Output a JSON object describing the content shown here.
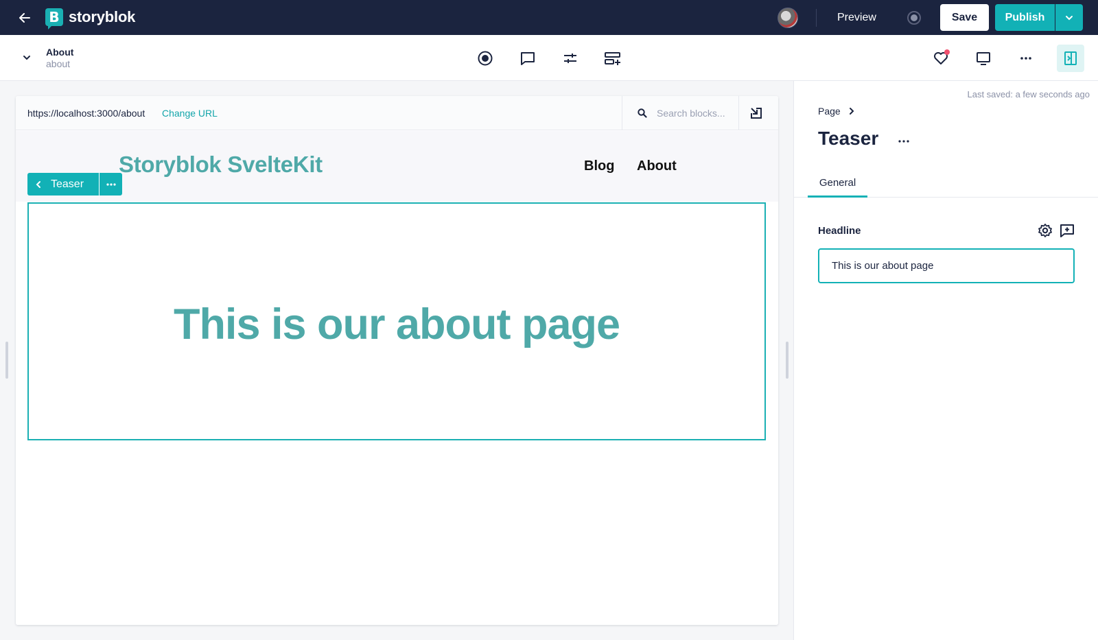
{
  "app": {
    "logo_letter": "B",
    "logo_text": "storyblok",
    "brand_color": "#12b1b6",
    "nav_bg": "#1b243f"
  },
  "topbar": {
    "preview_label": "Preview",
    "save_label": "Save",
    "publish_label": "Publish"
  },
  "story": {
    "name": "About",
    "slug": "about"
  },
  "toolbar_icons": [
    "target-icon",
    "comment-icon",
    "sliders-icon",
    "add-block-icon"
  ],
  "preview": {
    "url": "https://localhost:3000/about",
    "change_url_label": "Change URL",
    "search_placeholder": "Search blocks...",
    "site_title": "Storyblok SvelteKit",
    "nav": [
      "Blog",
      "About"
    ],
    "block_label": "Teaser",
    "teaser_headline": "This is our about page",
    "teaser_color": "#4fa9a8"
  },
  "panel": {
    "last_saved": "Last saved: a few seconds ago",
    "breadcrumb": "Page",
    "title": "Teaser",
    "tab_general": "General",
    "field_label": "Headline",
    "field_value": "This is our about page"
  }
}
